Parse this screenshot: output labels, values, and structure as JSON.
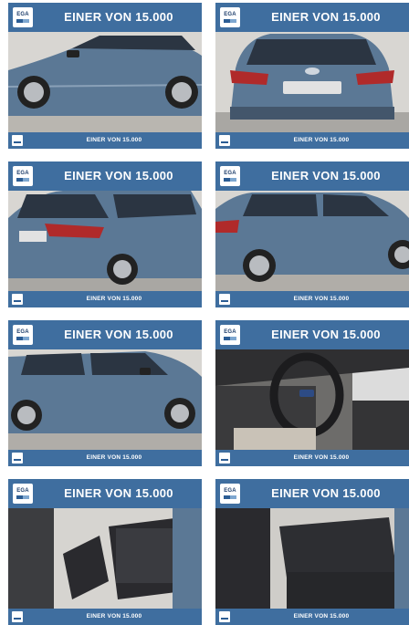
{
  "logo_text": "EGA",
  "cards": [
    {
      "title": "EINER VON 15.000",
      "footer": "EINER VON 15.000",
      "photo": "car-side-front"
    },
    {
      "title": "EINER VON 15.000",
      "footer": "EINER VON 15.000",
      "photo": "car-rear"
    },
    {
      "title": "EINER VON 15.000",
      "footer": "EINER VON 15.000",
      "photo": "car-rear-quarter"
    },
    {
      "title": "EINER VON 15.000",
      "footer": "EINER VON 15.000",
      "photo": "car-side-rear"
    },
    {
      "title": "EINER VON 15.000",
      "footer": "EINER VON 15.000",
      "photo": "car-side"
    },
    {
      "title": "EINER VON 15.000",
      "footer": "EINER VON 15.000",
      "photo": "interior-dashboard"
    },
    {
      "title": "EINER VON 15.000",
      "footer": "EINER VON 15.000",
      "photo": "interior-front-seats"
    },
    {
      "title": "EINER VON 15.000",
      "footer": "EINER VON 15.000",
      "photo": "interior-rear-seats"
    }
  ],
  "colors": {
    "banner": "#3f6e9f",
    "car_body": "#5b7895",
    "seat": "#2a2a2e"
  }
}
